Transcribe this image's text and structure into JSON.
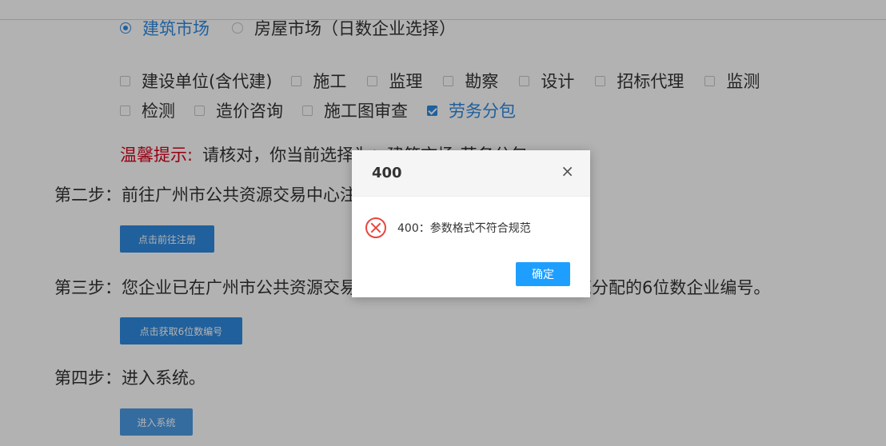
{
  "market": {
    "options": [
      {
        "label": "建筑市场",
        "checked": true
      },
      {
        "label": "房屋市场（日数企业选择）",
        "checked": false
      }
    ]
  },
  "roles": {
    "row1": [
      {
        "label": "建设单位(含代建)",
        "checked": false
      },
      {
        "label": "施工",
        "checked": false
      },
      {
        "label": "监理",
        "checked": false
      },
      {
        "label": "勘察",
        "checked": false
      },
      {
        "label": "设计",
        "checked": false
      },
      {
        "label": "招标代理",
        "checked": false
      },
      {
        "label": "监测",
        "checked": false
      }
    ],
    "row2": [
      {
        "label": "检测",
        "checked": false
      },
      {
        "label": "造价咨询",
        "checked": false
      },
      {
        "label": "施工图审查",
        "checked": false
      },
      {
        "label": "劳务分包",
        "checked": true
      }
    ]
  },
  "tip": {
    "label": "温馨提示:",
    "text": "请核对，你当前选择为：建筑市场-劳务分包"
  },
  "steps": {
    "step2": {
      "text": "第二步：前往广州市公共资源交易中心注册，如已注册，请直接前往。",
      "button": "点击前往注册"
    },
    "step3": {
      "text": "第三步：您企业已在广州市公共资源交易中心注册，请获取交易中心为您分配的6位数企业编号。",
      "button": "点击获取6位数编号"
    },
    "step4": {
      "text": "第四步：进入系统。",
      "button": "进入系统"
    }
  },
  "dialog": {
    "title": "400",
    "close": "×",
    "message": "400：参数格式不符合规范",
    "ok": "确定",
    "icon": "error-x-icon"
  },
  "colors": {
    "accent": "#2f8ae0",
    "tip_red": "#d9001b",
    "ok_button": "#1e9fff",
    "error": "#e8463f"
  }
}
